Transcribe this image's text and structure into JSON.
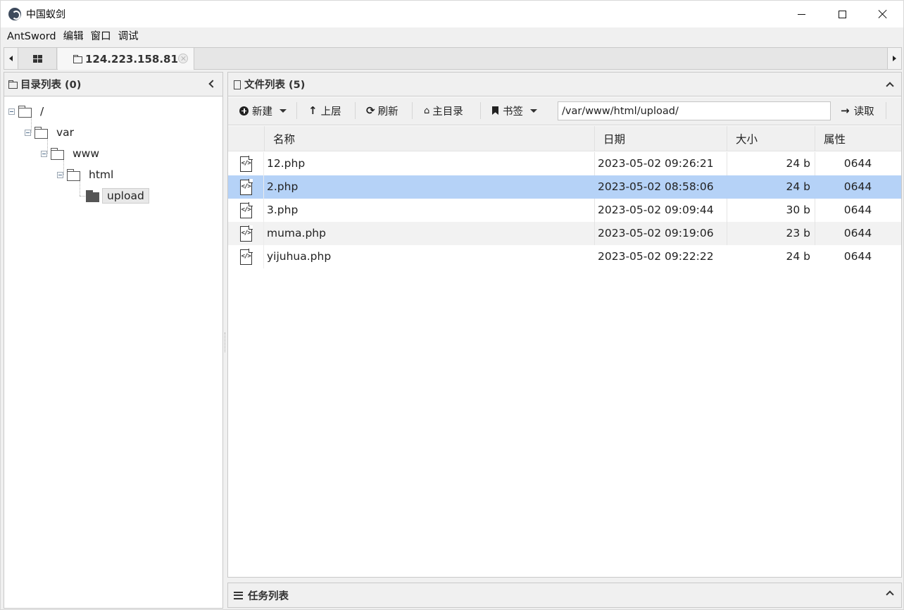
{
  "window": {
    "title": "中国蚁剑"
  },
  "menu": [
    "AntSword",
    "编辑",
    "窗口",
    "调试"
  ],
  "tabs": {
    "active_label": "124.223.158.81"
  },
  "left_panel": {
    "title": "目录列表 (0)",
    "tree": [
      {
        "label": "/",
        "depth": 0
      },
      {
        "label": "var",
        "depth": 1
      },
      {
        "label": "www",
        "depth": 2
      },
      {
        "label": "html",
        "depth": 3
      },
      {
        "label": "upload",
        "depth": 4,
        "selected": true
      }
    ]
  },
  "right_panel": {
    "title": "文件列表 (5)",
    "toolbar": {
      "new_label": "新建",
      "up_label": "上层",
      "refresh_label": "刷新",
      "home_label": "主目录",
      "bookmark_label": "书签",
      "path_value": "/var/www/html/upload/",
      "read_label": "读取"
    },
    "columns": {
      "name": "名称",
      "date": "日期",
      "size": "大小",
      "attr": "属性"
    },
    "files": [
      {
        "name": "12.php",
        "date": "2023-05-02 09:26:21",
        "size": "24 b",
        "attr": "0644",
        "icon": "code-file-icon"
      },
      {
        "name": "2.php",
        "date": "2023-05-02 08:58:06",
        "size": "24 b",
        "attr": "0644",
        "icon": "code-file-icon",
        "selected": true
      },
      {
        "name": "3.php",
        "date": "2023-05-02 09:09:44",
        "size": "30 b",
        "attr": "0644",
        "icon": "code-file-icon"
      },
      {
        "name": "muma.php",
        "date": "2023-05-02 09:19:06",
        "size": "23 b",
        "attr": "0644",
        "icon": "code-file-icon"
      },
      {
        "name": "yijuhua.php",
        "date": "2023-05-02 09:22:22",
        "size": "24 b",
        "attr": "0644",
        "icon": "code-file-icon"
      }
    ]
  },
  "task_panel": {
    "title": "任务列表"
  },
  "colors": {
    "selection": "#b5d2f7",
    "panel_bg": "#f0f0f0",
    "row_alt": "#f2f2f2"
  }
}
